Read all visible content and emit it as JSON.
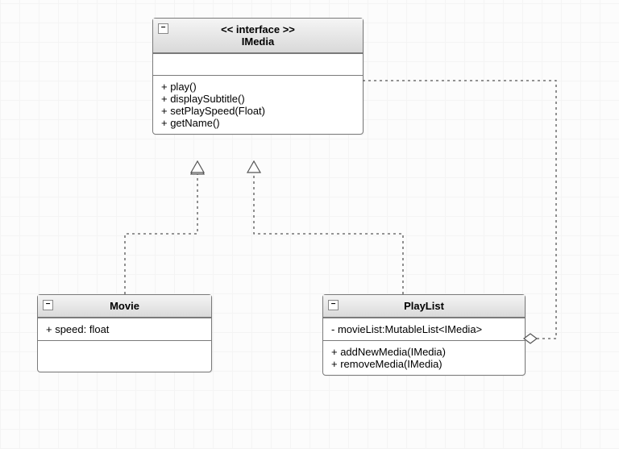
{
  "chart_data": {
    "type": "uml_class_diagram",
    "classes": [
      {
        "id": "IMedia",
        "stereotype": "<< interface >>",
        "name": "IMedia",
        "attributes": [],
        "methods": [
          "+ play()",
          "+ displaySubtitle()",
          "+ setPlaySpeed(Float)",
          "+ getName()"
        ]
      },
      {
        "id": "Movie",
        "name": "Movie",
        "attributes": [
          "+ speed: float"
        ],
        "methods": []
      },
      {
        "id": "PlayList",
        "name": "PlayList",
        "attributes": [
          "- movieList:MutableList<IMedia>"
        ],
        "methods": [
          "+ addNewMedia(IMedia)",
          "+ removeMedia(IMedia)"
        ]
      }
    ],
    "relationships": [
      {
        "from": "Movie",
        "to": "IMedia",
        "type": "realization"
      },
      {
        "from": "PlayList",
        "to": "IMedia",
        "type": "realization"
      },
      {
        "from": "PlayList",
        "to": "IMedia",
        "type": "aggregation",
        "aggregate_side": "PlayList"
      }
    ]
  },
  "imedia": {
    "stereotype": "<< interface >>",
    "name": "IMedia",
    "m1": "+ play()",
    "m2": "+ displaySubtitle()",
    "m3": "+ setPlaySpeed(Float)",
    "m4": "+ getName()"
  },
  "movie": {
    "name": "Movie",
    "a1": "+ speed: float"
  },
  "playlist": {
    "name": "PlayList",
    "a1": "- movieList:MutableList<IMedia>",
    "m1": "+ addNewMedia(IMedia)",
    "m2": "+ removeMedia(IMedia)"
  },
  "icons": {
    "collapse": "−"
  }
}
